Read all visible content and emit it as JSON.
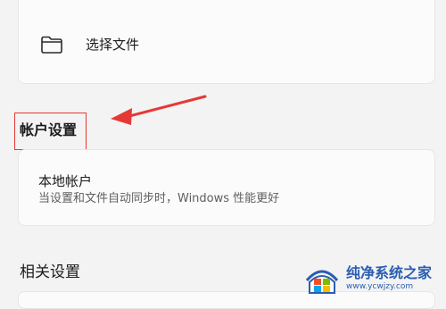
{
  "top_card": {
    "choose_file_label": "选择文件"
  },
  "account_settings": {
    "title": "帐户设置"
  },
  "local_account_card": {
    "title": "本地帐户",
    "description": "当设置和文件自动同步时，Windows 性能更好"
  },
  "related_settings": {
    "title": "相关设置"
  },
  "watermark": {
    "name": "纯净系统之家",
    "url": "www.ycwjzy.com"
  },
  "annotations": {
    "highlight_color": "#e53935",
    "arrow_color": "#e53935"
  }
}
